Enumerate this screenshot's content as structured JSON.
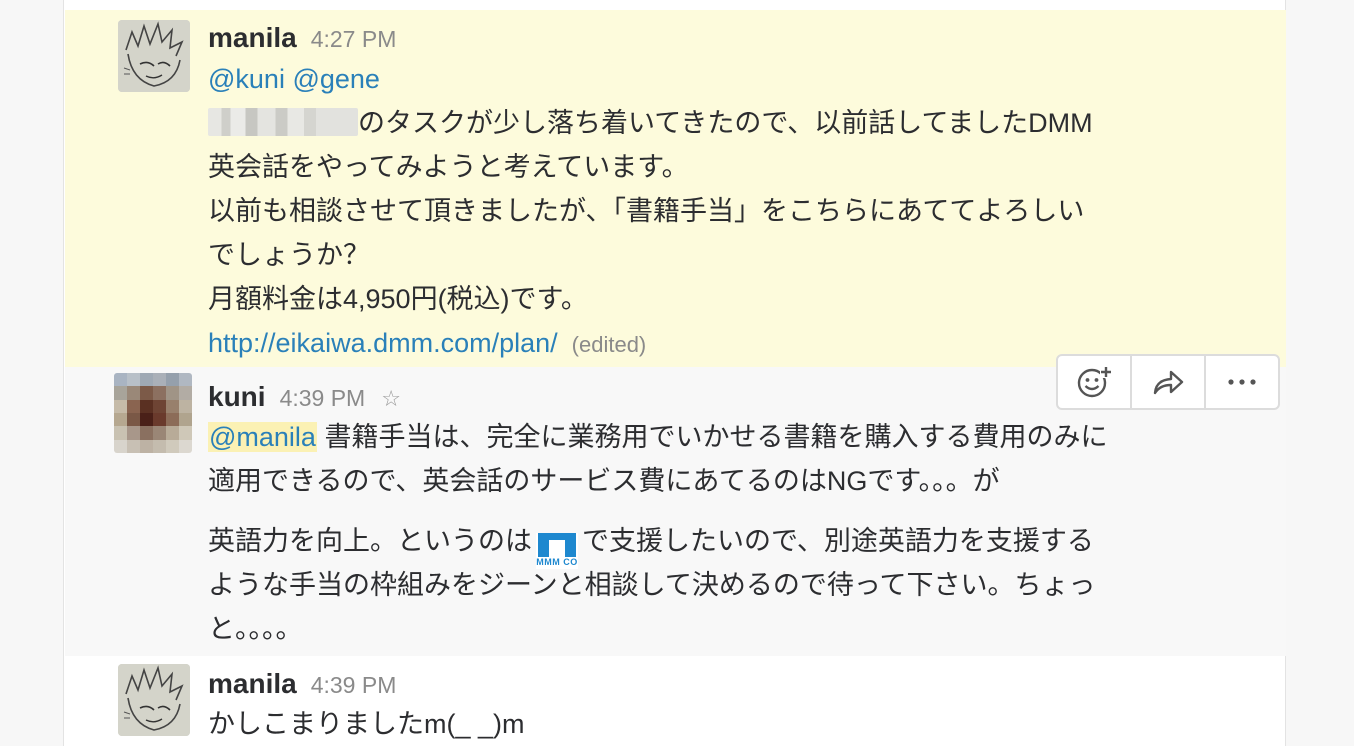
{
  "messages": [
    {
      "sender": "manila",
      "time": "4:27 PM",
      "mentions": "@kuni @gene",
      "line1": "のタスクが少し落ち着いてきたので、以前話してましたDMM",
      "line2": "英会話をやってみようと考えています。",
      "line3": "以前も相談させて頂きましたが、「書籍手当」をこちらにあててよろしい",
      "line4": "でしょうか？",
      "line5": "月額料金は4,950円(税込)です。",
      "link": "http://eikaiwa.dmm.com/plan/",
      "edited": "(edited)"
    },
    {
      "sender": "kuni",
      "time": "4:39 PM",
      "mention": "@manila",
      "line1_rest": " 書籍手当は、完全に業務用でいかせる書籍を購入する費用のみに",
      "line2": "適用できるので、英会話のサービス費にあてるのはNGです。。。が",
      "line3_a": "英語力を向上。というのは",
      "line3_b": "で支援したいので、別途英語力を支援する",
      "line4": "ような手当の枠組みをジーンと相談して決めるので待って下さい。ちょっ",
      "line5": "と。。。。",
      "emoji_caption": "MMM CO"
    },
    {
      "sender": "manila",
      "time": "4:39 PM",
      "line1": "かしこまりましたm(_ _)m"
    }
  ],
  "icons": {
    "star": "☆",
    "add_reaction": "add-reaction-icon",
    "share": "share-icon",
    "more": "⋯"
  },
  "colors": {
    "highlight_bg": "#fdfbdc",
    "link": "#2a80b9",
    "mention_bg": "#fbf1b4"
  }
}
